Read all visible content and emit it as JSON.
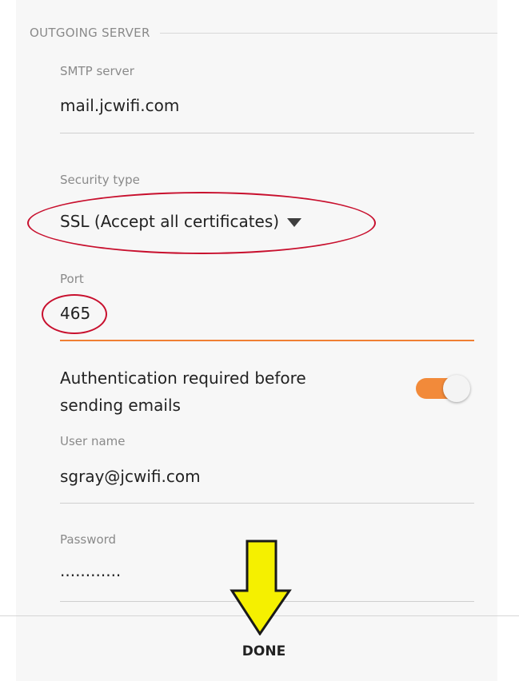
{
  "section": {
    "title": "OUTGOING SERVER"
  },
  "smtp": {
    "label": "SMTP server",
    "value": "mail.jcwifi.com"
  },
  "security": {
    "label": "Security type",
    "value": "SSL (Accept all certificates)"
  },
  "port": {
    "label": "Port",
    "value": "465"
  },
  "auth": {
    "text": "Authentication required before sending emails",
    "enabled": true
  },
  "username": {
    "label": "User name",
    "value": "sgray@jcwifi.com"
  },
  "password": {
    "label": "Password",
    "value": "............"
  },
  "footer": {
    "done_label": "DONE"
  },
  "colors": {
    "accent": "#f07f33",
    "annotation_circle": "#c8102e",
    "annotation_arrow": "#f5f000"
  }
}
